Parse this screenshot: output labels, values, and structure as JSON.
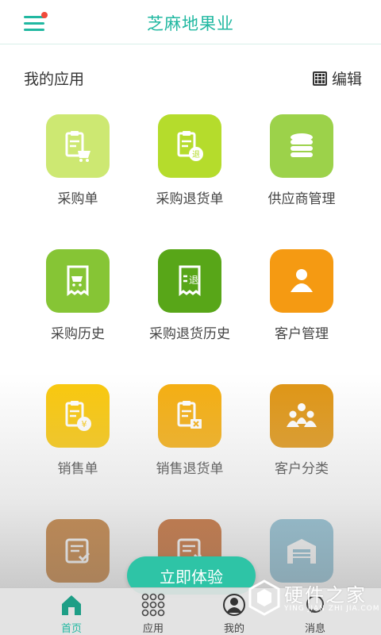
{
  "header": {
    "title": "芝麻地果业"
  },
  "section": {
    "title": "我的应用",
    "edit_label": "编辑"
  },
  "apps": [
    {
      "label": "采购单",
      "color": "#cde872",
      "icon": "purchase-order-icon"
    },
    {
      "label": "采购退货单",
      "color": "#b5dc2c",
      "icon": "purchase-return-icon"
    },
    {
      "label": "供应商管理",
      "color": "#9cd24a",
      "icon": "supplier-database-icon"
    },
    {
      "label": "采购历史",
      "color": "#86c535",
      "icon": "purchase-history-icon"
    },
    {
      "label": "采购退货历史",
      "color": "#58a618",
      "icon": "return-history-icon"
    },
    {
      "label": "客户管理",
      "color": "#f59a12",
      "icon": "customer-icon"
    },
    {
      "label": "销售单",
      "color": "#fac80a",
      "icon": "sales-order-icon"
    },
    {
      "label": "销售退货单",
      "color": "#f6ae0e",
      "icon": "sales-return-icon"
    },
    {
      "label": "客户分类",
      "color": "#e09512",
      "icon": "customer-group-icon"
    },
    {
      "label": "",
      "color": "#bd6d1e",
      "icon": "checklist-icon"
    },
    {
      "label": "",
      "color": "#c05714",
      "icon": "cancel-list-icon"
    },
    {
      "label": "",
      "color": "#7fb8cf",
      "icon": "warehouse-icon"
    }
  ],
  "try_button": {
    "label": "立即体验"
  },
  "tabs": [
    {
      "label": "首页",
      "icon": "home-icon",
      "active": true
    },
    {
      "label": "应用",
      "icon": "apps-grid-icon",
      "active": false
    },
    {
      "label": "我的",
      "icon": "profile-icon",
      "active": false
    },
    {
      "label": "消息",
      "icon": "message-icon",
      "active": false
    }
  ],
  "watermark": {
    "name": "硬件之家",
    "sub": "YING JIAN ZHI JIA.COM"
  },
  "colors": {
    "accent": "#21b8a1",
    "button": "#2ec4a6",
    "badge": "#f04a3b"
  }
}
